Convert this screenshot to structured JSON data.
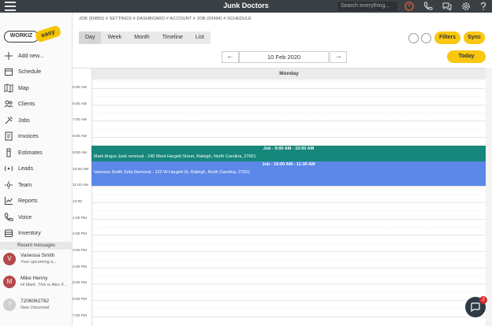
{
  "topbar": {
    "title": "Junk Doctors",
    "search_placeholder": "Search everything..."
  },
  "logo": {
    "main": "WORKIZ",
    "badge": "easy"
  },
  "sidebar": {
    "items": [
      {
        "label": "Add new...",
        "icon": "plus-icon"
      },
      {
        "label": "Schedule",
        "icon": "calendar-icon"
      },
      {
        "label": "Map",
        "icon": "map-icon"
      },
      {
        "label": "Clients",
        "icon": "clients-icon"
      },
      {
        "label": "Jobs",
        "icon": "tools-icon"
      },
      {
        "label": "Invoices",
        "icon": "invoice-icon"
      },
      {
        "label": "Estimates",
        "icon": "estimate-icon"
      },
      {
        "label": "Leads",
        "icon": "leads-icon"
      },
      {
        "label": "Team",
        "icon": "team-icon"
      },
      {
        "label": "Reports",
        "icon": "reports-icon"
      },
      {
        "label": "Voice",
        "icon": "phone-icon"
      },
      {
        "label": "Inventory",
        "icon": "inventory-icon"
      }
    ],
    "recent_header": "Recent messages",
    "messages": [
      {
        "initial": "V",
        "name": "Vanessa Smith",
        "preview": "Your upcoming a...",
        "color": "#b5484a"
      },
      {
        "initial": "M",
        "name": "Mike Henny",
        "preview": "Hi Mark. This is Alex F...",
        "color": "#b5484a"
      },
      {
        "initial": "?",
        "name": "7206062782",
        "preview": "New Voicemail",
        "color": "#cfcfcf"
      }
    ]
  },
  "breadcrumb": "JOB (90850) # SETTINGS # DASHBOARD # ACCOUNT # JOB (93494) # SCHEDULE",
  "view_tabs": [
    "Day",
    "Week",
    "Month",
    "Timeline",
    "List"
  ],
  "active_tab": "Day",
  "buttons": {
    "filters": "Filters",
    "sync": "Sync",
    "today": "Today"
  },
  "date_nav": {
    "prev": "←",
    "date": "10 Feb 2020",
    "next": "→"
  },
  "calendar": {
    "day_header": "Monday",
    "time_labels": [
      "5:00 AM",
      "6:00 AM",
      "7:00 AM",
      "8:00 AM",
      "9:00 AM",
      "10:00 AM",
      "11:00 AM",
      "12:00",
      "1:00 PM",
      "2:00 PM",
      "3:00 PM",
      "4:00 PM",
      "5:00 PM",
      "6:00 PM",
      "7:00 PM"
    ],
    "events": [
      {
        "title": "Job - 9:00 AM - 10:00 AM",
        "description": "Mark Angus Junk removal - 240 West Hargett Street, Raleigh, North Carolina, 27601",
        "color": "#16877a"
      },
      {
        "title": "Job - 10:00 AM - 11:30 AM",
        "description": "Vanessa Smith Sofa Removal - 222 W Hargett St, Raleigh, North Carolina, 27601",
        "color": "#5b88e8"
      }
    ]
  },
  "chat": {
    "badge": "2"
  },
  "colors": {
    "topbar": "#3a3f44",
    "accent_yellow": "#f9c710"
  }
}
